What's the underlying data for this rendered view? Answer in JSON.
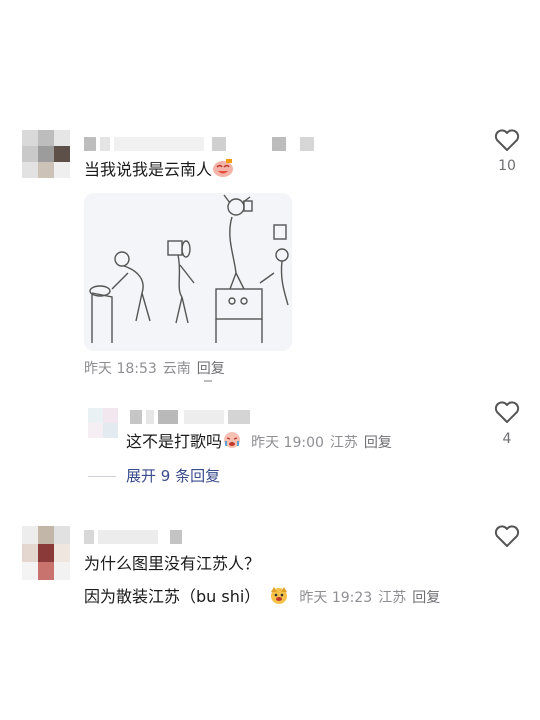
{
  "comments": [
    {
      "text": "当我说我是云南人",
      "emoji": "face-with-tears-emoji",
      "time": "昨天 18:53",
      "location": "云南",
      "reply_label": "回复",
      "like_count": "10"
    },
    {
      "text": "这不是打歌吗",
      "emoji": "crying-face-emoji",
      "time": "昨天 19:00",
      "location": "江苏",
      "reply_label": "回复",
      "like_count": "4"
    },
    {
      "line1": "为什么图里没有江苏人？",
      "line2": "因为散装江苏（bu shi）",
      "emoji": "dog-face-emoji",
      "time": "昨天 19:23",
      "location": "江苏",
      "reply_label": "回复",
      "like_count": ""
    }
  ],
  "expand_replies": "展开 9 条回复",
  "icons": {
    "like": "heart-icon"
  },
  "colors": {
    "expand_link": "#3a4b8c",
    "meta": "#8e8e93"
  }
}
